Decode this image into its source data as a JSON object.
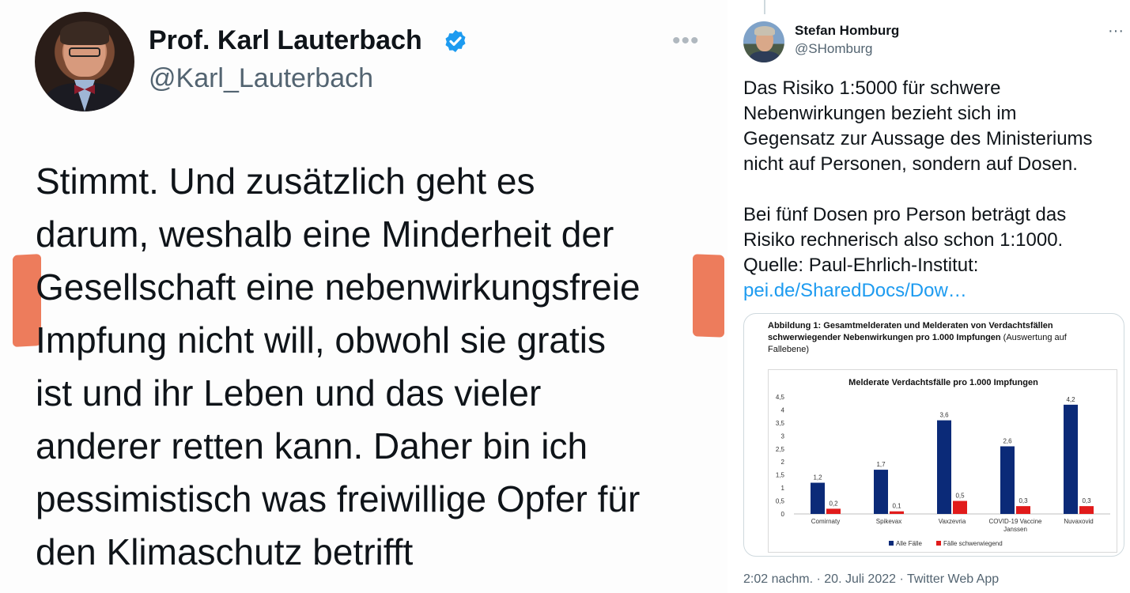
{
  "left_tweet": {
    "display_name": "Prof. Karl Lauterbach",
    "handle": "@Karl_Lauterbach",
    "more_icon": "…",
    "text_lines": [
      "Stimmt. Und zusätzlich geht es",
      "darum, weshalb eine Minderheit der",
      "Gesellschaft eine nebenwirkungsfreie",
      "Impfung nicht will, obwohl sie gratis",
      "ist und ihr Leben und das vieler",
      "anderer retten kann. Daher bin ich",
      "pessimistisch was freiwillige Opfer für",
      "den Klimaschutz betrifft"
    ],
    "highlight_color": "#ea6a45",
    "verified_color": "#1d9bf0"
  },
  "right_tweet": {
    "display_name": "Stefan Homburg",
    "handle": "@SHomburg",
    "more_icon": "···",
    "para1": [
      "Das Risiko 1:5000 für schwere",
      "Nebenwirkungen bezieht sich im",
      "Gegensatz zur Aussage des Ministeriums",
      "nicht auf Personen, sondern auf Dosen."
    ],
    "para2": [
      "Bei fünf Dosen pro Person beträgt das",
      "Risiko rechnerisch also schon 1:1000.",
      "Quelle: Paul-Ehrlich-Institut:"
    ],
    "link": "pei.de/SharedDocs/Dow…",
    "link_color": "#1d9bf0",
    "card_caption_bold": "Abbildung 1: Gesamtmelderaten und Melderaten von Verdachtsfällen schwerwiegender Nebenwirkungen pro 1.000 Impfungen",
    "card_caption_rest": " (Auswertung auf Fallebene)",
    "footer": "2:02 nachm. · 20. Juli 2022 · Twitter Web App"
  },
  "chart_data": {
    "type": "bar",
    "title": "Melderate Verdachtsfälle pro 1.000 Impfungen",
    "categories": [
      "Comirnaty",
      "Spikevax",
      "Vaxzevria",
      "COVID-19 Vaccine Janssen",
      "Nuvaxovid"
    ],
    "category_lines": [
      [
        "Comirnaty"
      ],
      [
        "Spikevax"
      ],
      [
        "Vaxzevria"
      ],
      [
        "COVID-19 Vaccine",
        "Janssen"
      ],
      [
        "Nuvaxovid"
      ]
    ],
    "series": [
      {
        "name": "Alle Fälle",
        "color": "#0b2a78",
        "values": [
          1.2,
          1.7,
          3.6,
          2.6,
          4.2
        ],
        "labels": [
          "1,2",
          "1,7",
          "3,6",
          "2,6",
          "4,2"
        ]
      },
      {
        "name": "Fälle schwerwiegend",
        "color": "#e11b1b",
        "values": [
          0.2,
          0.1,
          0.5,
          0.3,
          0.3
        ],
        "labels": [
          "0,2",
          "0,1",
          "0,5",
          "0,3",
          "0,3"
        ]
      }
    ],
    "ylim": [
      0,
      4.5
    ],
    "yticks": [
      "0",
      "0,5",
      "1",
      "1,5",
      "2",
      "2,5",
      "3",
      "3,5",
      "4",
      "4,5"
    ],
    "legend_position": "bottom",
    "grid": false
  }
}
